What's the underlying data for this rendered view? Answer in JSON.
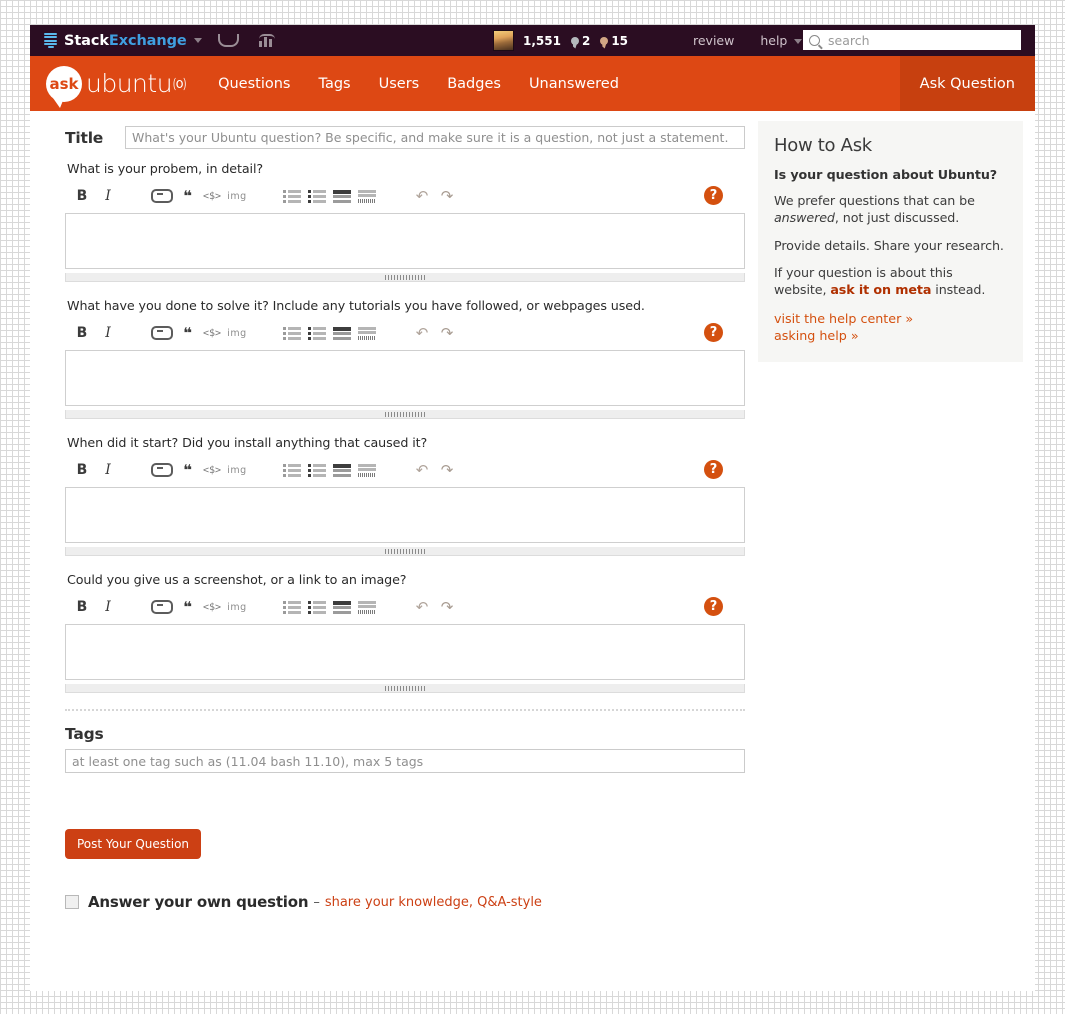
{
  "topbar": {
    "logo_icon": "stack-exchange-icon",
    "site_name_1": "Stack",
    "site_name_2": "Exchange",
    "inbox_icon": "inbox-icon",
    "achievements_icon": "achievements-icon",
    "avatar": "user-avatar",
    "reputation": "1,551",
    "silver_badge_count": "2",
    "bronze_badge_count": "15",
    "review_label": "review",
    "help_label": "help",
    "search": {
      "placeholder": "search",
      "value": "",
      "icon": "search-icon"
    }
  },
  "nav": {
    "logo_bubble": "ask",
    "logo_word": "ubuntu",
    "logo_mark": "⒪",
    "items": [
      {
        "label": "Questions"
      },
      {
        "label": "Tags"
      },
      {
        "label": "Users"
      },
      {
        "label": "Badges"
      },
      {
        "label": "Unanswered"
      }
    ],
    "ask_question": "Ask Question"
  },
  "form": {
    "title_label": "Title",
    "title_placeholder": "What's your Ubuntu question? Be specific, and make sure it is a question, not just a statement.",
    "title_value": "",
    "editors": [
      {
        "label": "What is your probem, in detail?",
        "value": ""
      },
      {
        "label": "What have you done to solve it? Include any tutorials you have followed, or webpages used.",
        "value": ""
      },
      {
        "label": "When did it start? Did you install anything that caused it?",
        "value": ""
      },
      {
        "label": "Could you give us a screenshot, or a link to an image?",
        "value": ""
      }
    ],
    "toolbar": {
      "bold": "B",
      "italic": "I",
      "link_icon": "link-icon",
      "quote": "❝",
      "code": "<$>",
      "image": "img",
      "numbered_list_icon": "numbered-list-icon",
      "bulleted_list_icon": "bulleted-list-icon",
      "heading_icon": "heading-icon",
      "horizontal_rule_icon": "horizontal-rule-icon",
      "undo": "↶",
      "redo": "↷",
      "help": "?"
    },
    "tags_label": "Tags",
    "tags_placeholder": "at least one tag such as (11.04 bash 11.10), max 5 tags",
    "tags_value": "",
    "post_button": "Post Your Question",
    "own_question_title": "Answer your own question",
    "own_question_dash": "–",
    "own_question_sub": "share your knowledge, Q&A-style",
    "own_question_checked": false
  },
  "sidebar": {
    "title": "How to Ask",
    "heading": "Is your question about Ubuntu?",
    "p1_a": "We prefer questions that can be ",
    "p1_em": "answered",
    "p1_b": ", not just discussed.",
    "p2": "Provide details. Share your research.",
    "p3_a": "If your question is about this website, ",
    "p3_strong": "ask it on meta",
    "p3_b": " instead.",
    "link1": "visit the help center »",
    "link2": "asking help »"
  },
  "colors": {
    "topbar_bg": "#2b0d22",
    "nav_bg": "#dd4814",
    "ask_btn_bg": "#c7400f",
    "accent": "#d4500f",
    "post_btn": "#cc4014",
    "sidebar_bg": "#f6f6f4"
  }
}
